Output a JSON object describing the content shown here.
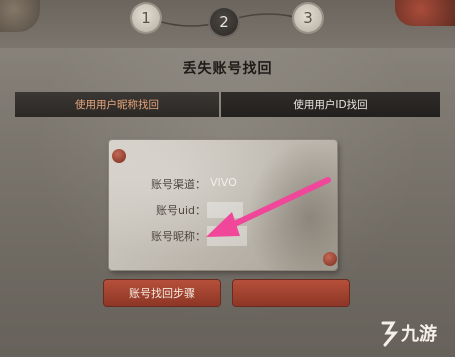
{
  "steps": [
    "1",
    "2",
    "3"
  ],
  "title": "丢失账号找回",
  "tabs": {
    "by_nickname": "使用用户昵称找回",
    "by_id": "使用用户ID找回"
  },
  "form": {
    "channel_label": "账号渠道：",
    "channel_value": "VIVO",
    "uid_label": "账号uid：",
    "nickname_label": "账号昵称："
  },
  "buttons": {
    "steps_label": "账号找回步骤"
  },
  "watermark": "九游",
  "colors": {
    "accent": "#b5503a",
    "annotation_arrow": "#f0479a",
    "active_tab_text": "#e9a77b"
  }
}
